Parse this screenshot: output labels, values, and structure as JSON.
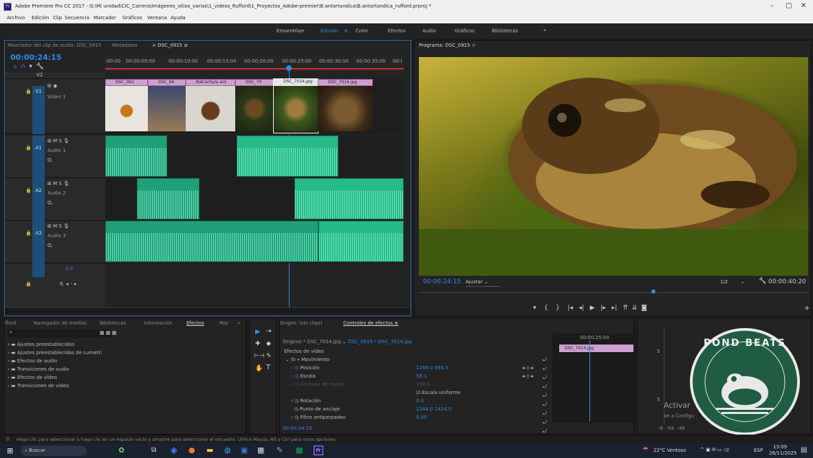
{
  "window": {
    "title": "Adobe Premiere Pro CC 2017 - G:\\Mi unidad\\CIC_Carrera\\Imágenes_sitios_varias\\1_videos_Rufford\\1_Proyectos_Adobe-premier\\B.antartandica\\B.antartandica_rufford.prproj *",
    "min": "–",
    "max": "▢",
    "close": "✕"
  },
  "menu": [
    "Archivo",
    "Edición",
    "Clip",
    "Secuencia",
    "Marcador",
    "Gráficos",
    "Ventana",
    "Ayuda"
  ],
  "workspaces": [
    "Ensamblaje",
    "Edición",
    "Color",
    "Efectos",
    "Audio",
    "Gráficos",
    "Bibliotecas"
  ],
  "workspace_more": "»",
  "workspace_menu_icon": "≡",
  "source_panel": {
    "tab1": "Mezclador del clip de audio: DSC_0915",
    "tab2": "Metadatos",
    "tab3": "DSC_0915",
    "tab3_menu": "≡"
  },
  "timeline": {
    "timecode": "00:00:24:15",
    "ruler": [
      ":00:00",
      "00:00:05:00",
      "00:00:10:00",
      "00:00:15:00",
      "00:00:20:00",
      "00:00:25:00",
      "00:00:30:00",
      "00:00:35:00",
      "00:("
    ],
    "tracks": [
      {
        "id": "V2",
        "name": ""
      },
      {
        "id": "V1",
        "name": "Vídeo 1"
      },
      {
        "id": "A1",
        "name": "Audio 1"
      },
      {
        "id": "A2",
        "name": "Audio 2"
      },
      {
        "id": "A3",
        "name": "Audio 3"
      }
    ],
    "video_clips": [
      "DSC_091",
      "DSC_69",
      "Batrachyla ant",
      "DSC_70",
      "DSC_7014.jpg",
      "DSC_7016.jpg"
    ],
    "master_value": "0.0",
    "toggle_labels": {
      "m": "M",
      "s": "S",
      "o": "O,",
      "fx": "fx"
    }
  },
  "program": {
    "title": "Programa: DSC_0915",
    "menu": "≡",
    "timecode": "00:00:24:15",
    "fit": "Ajustar",
    "fraction": "1/2",
    "duration": "00:00:40:20"
  },
  "bottom_left": {
    "tabs": [
      "fford",
      "Navegador de medios",
      "Bibliotecas",
      "Información",
      "Efectos",
      "Mar"
    ],
    "more": "»",
    "search_icon": "⌕",
    "items": [
      "Ajustes preestablecidos",
      "Ajustes preestablecidos de Lumetri",
      "Efectos de audio",
      "Transiciones de audio",
      "Efectos de vídeo",
      "Transiciones de vídeo"
    ]
  },
  "effect_controls": {
    "tab_origin": "Origen: (sin clips)",
    "tab_ec": "Controles de efectos",
    "menu": "≡",
    "master": "Original * DSC_7014.jpg",
    "sequence": "DSC_0915 * DSC_7014.jpg",
    "section": "Efectos de vídeo",
    "fx_label": "Movimiento",
    "rows": [
      {
        "name": "Posición",
        "value": "1169.0  594.5"
      },
      {
        "name": "Escala",
        "value": "59.1"
      },
      {
        "name": "Anchura de escala",
        "value": "100.0"
      },
      {
        "name": "",
        "value": "Escala uniforme"
      },
      {
        "name": "Rotación",
        "value": "0.0"
      },
      {
        "name": "Punto de anclaje",
        "value": "2144.0  1424.0"
      },
      {
        "name": "Filtro antiparpadeo",
        "value": "0.00"
      }
    ],
    "timecode": "00:00:24:15",
    "mini_ruler": "00:00:25:00",
    "mini_clip": "DSC_7014.jpg"
  },
  "audio_meter": {
    "scale": [
      "-6",
      "-54",
      "-48"
    ],
    "s": "S"
  },
  "watermark": {
    "activate": "Activar",
    "sub": "Ve a Configu"
  },
  "logo": {
    "text": "POND BEATS"
  },
  "status": "Haga clic para seleccionar o haga clic en un espacio vacío y arrastre para seleccionar el recuadro. Utilice Mayús, Alt y Ctrl para otras opciones.",
  "taskbar": {
    "search": "Buscar",
    "weather": "22°C Ventoso",
    "lang": "ESP",
    "time": "13:09",
    "date": "26/11/2025"
  },
  "colors": {
    "accent": "#2d8ceb",
    "clip_video": "#cfa0cf",
    "clip_audio": "#1fa07a",
    "logo_green": "#1f5c43"
  }
}
